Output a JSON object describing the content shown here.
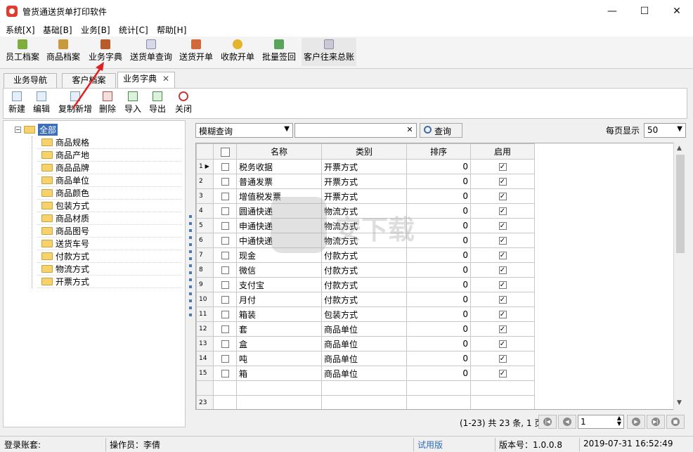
{
  "window": {
    "title": "管货通送货单打印软件",
    "minimize": "—",
    "maximize": "☐",
    "close": "✕"
  },
  "menu": [
    "系统[X]",
    "基础[B]",
    "业务[B]",
    "统计[C]",
    "帮助[H]"
  ],
  "toolbar": [
    "员工档案",
    "商品档案",
    "业务字典",
    "送货单查询",
    "送货开单",
    "收款开单",
    "批量签回",
    "客户往来总账"
  ],
  "tabs": [
    {
      "label": "业务导航"
    },
    {
      "label": "客户档案"
    },
    {
      "label": "业务字典",
      "close": "✕"
    }
  ],
  "actions": [
    "新建",
    "编辑",
    "复制新增",
    "删除",
    "导入",
    "导出",
    "关闭"
  ],
  "tree": {
    "root": "全部",
    "items": [
      "商品规格",
      "商品产地",
      "商品品牌",
      "商品单位",
      "商品颜色",
      "包装方式",
      "商品材质",
      "商品图号",
      "送货车号",
      "付款方式",
      "物流方式",
      "开票方式"
    ]
  },
  "filter": {
    "mode": "模糊查询",
    "query_label": "查询",
    "per_page_label": "每页显示",
    "per_page": "50"
  },
  "grid": {
    "headers": [
      "名称",
      "类别",
      "排序",
      "启用"
    ],
    "rows": [
      {
        "n": "1",
        "name": "税务收据",
        "type": "开票方式",
        "sort": "0"
      },
      {
        "n": "2",
        "name": "普通发票",
        "type": "开票方式",
        "sort": "0"
      },
      {
        "n": "3",
        "name": "增值税发票",
        "type": "开票方式",
        "sort": "0"
      },
      {
        "n": "4",
        "name": "圆通快递",
        "type": "物流方式",
        "sort": "0"
      },
      {
        "n": "5",
        "name": "申通快递",
        "type": "物流方式",
        "sort": "0"
      },
      {
        "n": "6",
        "name": "中通快递",
        "type": "物流方式",
        "sort": "0"
      },
      {
        "n": "7",
        "name": "现金",
        "type": "付款方式",
        "sort": "0"
      },
      {
        "n": "8",
        "name": "微信",
        "type": "付款方式",
        "sort": "0"
      },
      {
        "n": "9",
        "name": "支付宝",
        "type": "付款方式",
        "sort": "0"
      },
      {
        "n": "10",
        "name": "月付",
        "type": "付款方式",
        "sort": "0"
      },
      {
        "n": "11",
        "name": "箱装",
        "type": "包装方式",
        "sort": "0"
      },
      {
        "n": "12",
        "name": "套",
        "type": "商品单位",
        "sort": "0"
      },
      {
        "n": "13",
        "name": "盒",
        "type": "商品单位",
        "sort": "0"
      },
      {
        "n": "14",
        "name": "吨",
        "type": "商品单位",
        "sort": "0"
      },
      {
        "n": "15",
        "name": "箱",
        "type": "商品单位",
        "sort": "0"
      }
    ],
    "total_count": "23"
  },
  "pager": {
    "summary": "(1-23) 共 23 条, 1 页",
    "page": "1"
  },
  "status": {
    "account": "登录账套:",
    "operator": "操作员：李倩",
    "trial": "试用版",
    "version": "版本号：1.0.0.8",
    "datetime": "2019-07-31   16:52:49"
  },
  "watermark": "安下载",
  "colors": {
    "accent": "#3c6fb8",
    "arrow": "#e02020",
    "trial": "#2e6db4"
  }
}
